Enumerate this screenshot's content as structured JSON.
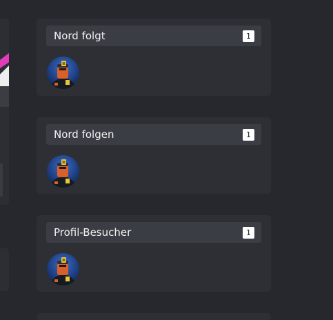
{
  "cards": [
    {
      "title": "Nord folgt",
      "count": "1"
    },
    {
      "title": "Nord folgen",
      "count": "1"
    },
    {
      "title": "Profil-Besucher",
      "count": "1"
    }
  ],
  "avatar": {
    "icon": "user-avatar-icon",
    "colors": {
      "background": "#1b3f8a",
      "face": "#d9602a",
      "helmet": "#161b22",
      "badge": "#e8c53a"
    }
  }
}
